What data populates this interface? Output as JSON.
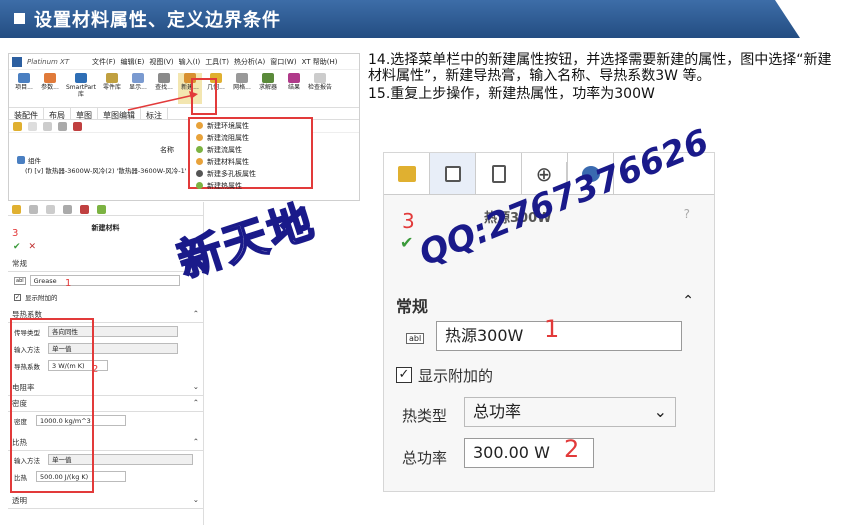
{
  "header": {
    "title": "设置材料属性、定义边界条件"
  },
  "app": {
    "name": "Platinum XT",
    "menu": [
      "文件(F)",
      "编辑(E)",
      "视图(V)",
      "输入(I)",
      "工具(T)",
      "热分析(A)",
      "窗口(W)",
      "XT 帮助(H)"
    ],
    "ribbon": [
      "项目...",
      "参数...",
      "SmartPart 库",
      "零件库",
      "显示...",
      "查找...",
      "新建...",
      "几何...",
      "网格...",
      "求解器",
      "结果",
      "检查报告"
    ],
    "tabs": [
      "装配件",
      "布局",
      "草图",
      "草图编辑",
      "标注"
    ],
    "col_header": "名称",
    "tree_root": "组件",
    "tree_item": "(f) [v] 散热器-3600W-风冷(2) '散热器-3600W-风冷-1'"
  },
  "dropdown": {
    "items": [
      "新建环境属性",
      "新建流阻属性",
      "新建流属性",
      "新建材料属性",
      "新建多孔板属性",
      "新建热属性"
    ],
    "colors": [
      "#e8a23a",
      "#e8a23a",
      "#7cb342",
      "#e8a23a",
      "#555555",
      "#7cb342"
    ]
  },
  "left_panel": {
    "title": "新建材料",
    "num": "3",
    "section_general": "常规",
    "name_value": "Grease",
    "num1": "1",
    "show_additional": "显示附加的",
    "section_thermal": "导热系数",
    "conductivity_type_label": "传导类型",
    "conductivity_type_value": "各向同性",
    "input_method_label": "输入方法",
    "input_method_value": "单一值",
    "conductivity_label": "导热系数",
    "conductivity_value": "3 W/(m K)",
    "num2": "2",
    "section_resistivity": "电阻率",
    "section_density": "密度",
    "density_label": "密度",
    "density_value": "1000.0 kg/m^3",
    "section_specific_heat": "比热",
    "sh_input_label": "输入方法",
    "sh_input_value": "单一值",
    "sh_label": "比热",
    "sh_value": "500.00 J/(kg K)",
    "section_transparency": "透明"
  },
  "instructions": {
    "line1": "14.选择菜单栏中的新建属性按钮，并选择需要新建的属性，图中选择“新建材料属性”，新建导热膏，输入名称、导热系数3W 等。",
    "line2": "15.重复上步操作，新建热属性，功率为300W"
  },
  "right_panel": {
    "num": "3",
    "title": "热源300W",
    "section": "常规",
    "name_value": "热源300W",
    "num1": "1",
    "show_additional": "显示附加的",
    "heat_type_label": "热类型",
    "heat_type_value": "总功率",
    "total_power_label": "总功率",
    "total_power_value": "300.00 W",
    "num2": "2"
  },
  "watermark": {
    "cn": "新天地",
    "qq": "QQ:2767376626"
  }
}
